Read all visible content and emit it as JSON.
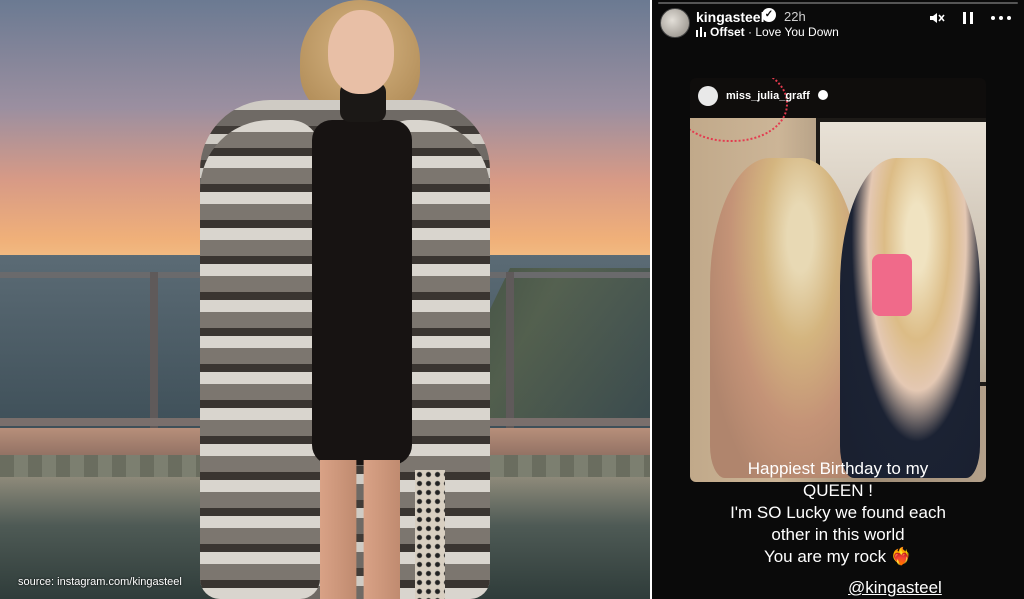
{
  "left_photo": {
    "source_caption": "source: instagram.com/kingasteel"
  },
  "story": {
    "username": "kingasteel",
    "verified": "✓",
    "time_ago": "22h",
    "music_prefix": "Offset",
    "music_suffix": " · Love You Down",
    "icons": {
      "mute": "speaker-mute-icon",
      "pause": "pause-icon",
      "more": "more-options-icon",
      "music": "music-bars-icon"
    },
    "shared_post": {
      "username": "miss_julia_graff"
    },
    "caption_lines": [
      "Happiest Birthday to my",
      "QUEEN !",
      "I'm SO Lucky we found each",
      "other in this world",
      "You are my rock ❤️‍🔥"
    ],
    "mention": "@kingasteel"
  }
}
